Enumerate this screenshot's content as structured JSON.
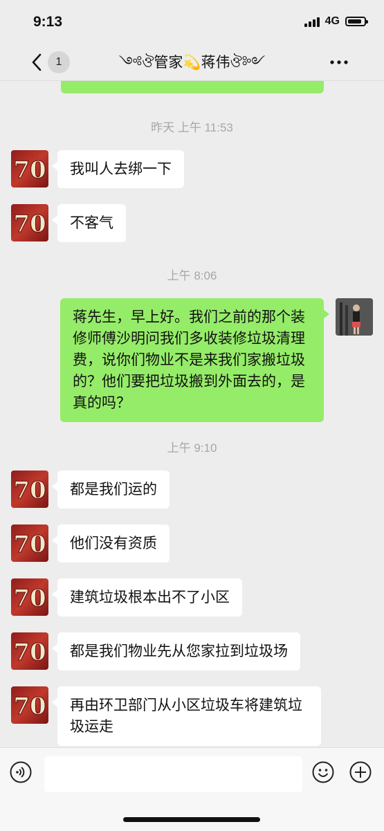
{
  "status_bar": {
    "time": "9:13",
    "network": "4G",
    "battery_level": 0.85
  },
  "nav": {
    "unread_count": "1",
    "title": "༺ঔ管家💫蒋伟ঔ༻"
  },
  "icons": {
    "back": "chevron-left-icon",
    "more": "more-dots-icon",
    "voice": "voice-icon",
    "emoji": "emoji-icon",
    "plus": "plus-icon"
  },
  "colors": {
    "outgoing_bubble": "#95ec69",
    "incoming_bubble": "#ffffff",
    "background": "#ededed",
    "timestamp": "#a6a6a6"
  },
  "messages": {
    "ts1": "昨天 上午 11:53",
    "m1": "我叫人去绑一下",
    "m2": "不客气",
    "ts2": "上午 8:06",
    "m3": "蒋先生，早上好。我们之前的那个装修师傅沙明问我们多收装修垃圾清理费，说你们物业不是来我们家搬垃圾的？他们要把垃圾搬到外面去的，是真的吗？",
    "ts3": "上午 9:10",
    "m4": "都是我们运的",
    "m5": "他们没有资质",
    "m6": "建筑垃圾根本出不了小区",
    "m7": "都是我们物业先从您家拉到垃圾场",
    "m8": "再由环卫部门从小区垃圾车将建筑垃圾运走"
  },
  "input": {
    "value": ""
  }
}
